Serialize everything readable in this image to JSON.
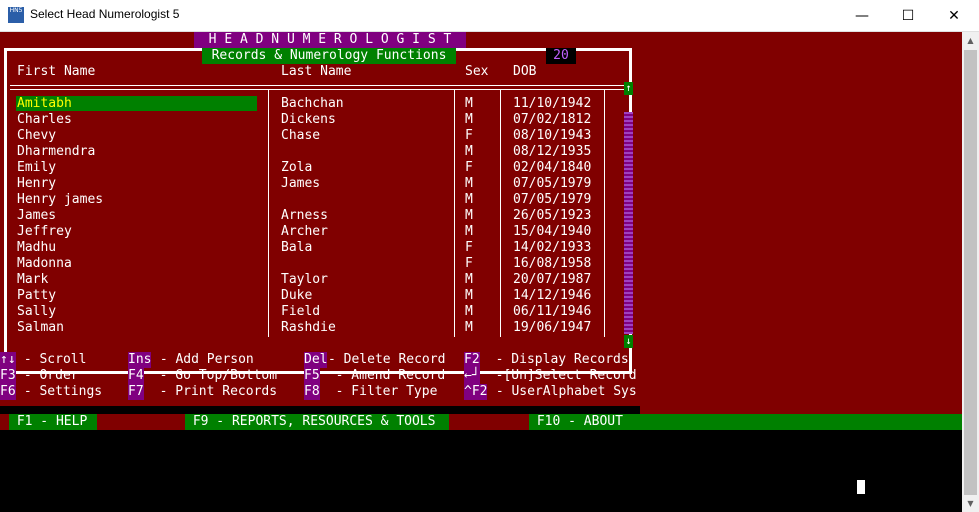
{
  "window": {
    "title": "Select Head Numerologist 5",
    "icon": "HN5",
    "minimize": "—",
    "maximize": "☐",
    "close": "✕"
  },
  "banner": {
    "title": "H E A D   N U M E R O L O G I S T",
    "subtitle": "Records & Numerology Functions",
    "count": "20"
  },
  "columns": {
    "first": "First Name",
    "last": "Last Name",
    "sex": "Sex",
    "dob": "DOB"
  },
  "rows": [
    {
      "first": "Amitabh",
      "last": "Bachchan",
      "sex": "M",
      "dob": "11/10/1942"
    },
    {
      "first": "Charles",
      "last": "Dickens",
      "sex": "M",
      "dob": "07/02/1812"
    },
    {
      "first": "Chevy",
      "last": "Chase",
      "sex": "F",
      "dob": "08/10/1943"
    },
    {
      "first": "Dharmendra",
      "last": "",
      "sex": "M",
      "dob": "08/12/1935"
    },
    {
      "first": "Emily",
      "last": "Zola",
      "sex": "F",
      "dob": "02/04/1840"
    },
    {
      "first": "Henry",
      "last": "James",
      "sex": "M",
      "dob": "07/05/1979"
    },
    {
      "first": "Henry james",
      "last": "",
      "sex": "M",
      "dob": "07/05/1979"
    },
    {
      "first": "James",
      "last": "Arness",
      "sex": "M",
      "dob": "26/05/1923"
    },
    {
      "first": "Jeffrey",
      "last": "Archer",
      "sex": "M",
      "dob": "15/04/1940"
    },
    {
      "first": "Madhu",
      "last": "Bala",
      "sex": "F",
      "dob": "14/02/1933"
    },
    {
      "first": "Madonna",
      "last": "",
      "sex": "F",
      "dob": "16/08/1958"
    },
    {
      "first": "Mark",
      "last": "Taylor",
      "sex": "M",
      "dob": "20/07/1987"
    },
    {
      "first": "Patty",
      "last": "Duke",
      "sex": "M",
      "dob": "14/12/1946"
    },
    {
      "first": "Sally",
      "last": "Field",
      "sex": "M",
      "dob": "06/11/1946"
    },
    {
      "first": "Salman",
      "last": "Rashdie",
      "sex": "M",
      "dob": "19/06/1947"
    }
  ],
  "scroll": {
    "up": "↑",
    "down": "↓"
  },
  "keys": [
    {
      "key": "↑↓",
      "desc": " - Scroll"
    },
    {
      "key": "Ins",
      "desc": " - Add Person"
    },
    {
      "key": "Del",
      "desc": "- Delete Record"
    },
    {
      "key": "F2",
      "desc": "  - Display Records"
    },
    {
      "key": "F3",
      "desc": " - Order"
    },
    {
      "key": "F4",
      "desc": "  - Go Top/Bottom"
    },
    {
      "key": "F5",
      "desc": "  - Amend Record"
    },
    {
      "key": "←┘",
      "desc": "  -[Un]Select Record"
    },
    {
      "key": "F6",
      "desc": " - Settings"
    },
    {
      "key": "F7",
      "desc": "  - Print Records"
    },
    {
      "key": "F8",
      "desc": "  - Filter Type"
    },
    {
      "key": "^F2",
      "desc": " - UserAlphabet Sys"
    }
  ],
  "menu": {
    "help": " F1 - HELP ",
    "reports": " F9 - REPORTS, RESOURCES & TOOLS ",
    "about": " F10 - ABOUT"
  },
  "colors": {
    "background": "#800000",
    "accent": "#008000",
    "key": "#800080"
  }
}
